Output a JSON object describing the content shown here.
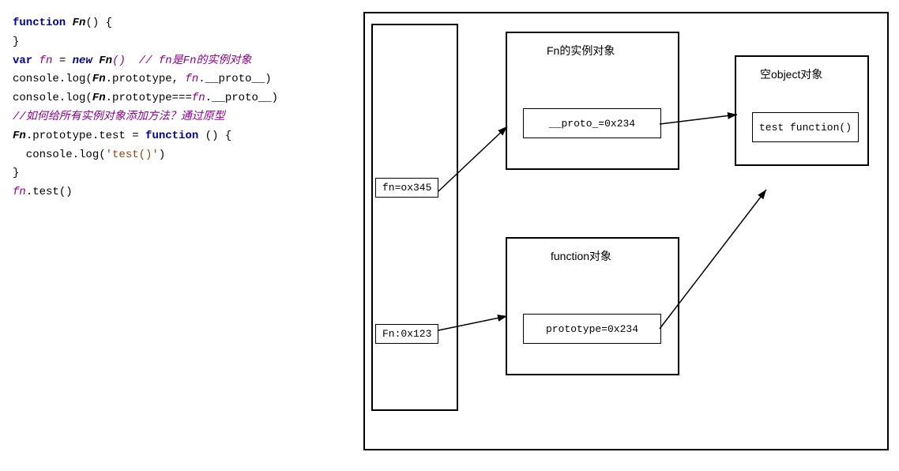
{
  "code": {
    "lines": [
      {
        "id": "l1",
        "parts": [
          {
            "text": "function ",
            "cls": "kw"
          },
          {
            "text": "Fn",
            "cls": "fn-name"
          },
          {
            "text": "() {",
            "cls": "plain"
          }
        ]
      },
      {
        "id": "l2",
        "parts": [
          {
            "text": "",
            "cls": "plain"
          }
        ]
      },
      {
        "id": "l3",
        "parts": [
          {
            "text": "}",
            "cls": "plain"
          }
        ]
      },
      {
        "id": "l4",
        "parts": [
          {
            "text": "var ",
            "cls": "var-kw"
          },
          {
            "text": "fn",
            "cls": "var-name"
          },
          {
            "text": " = ",
            "cls": "plain"
          },
          {
            "text": "new ",
            "cls": "new-kw"
          },
          {
            "text": "Fn",
            "cls": "fn-name"
          },
          {
            "text": "()  // fn是Fn的实例对象",
            "cls": "comment"
          }
        ]
      },
      {
        "id": "l5",
        "parts": [
          {
            "text": "console.log(",
            "cls": "method"
          },
          {
            "text": "Fn",
            "cls": "fn-name"
          },
          {
            "text": ".prototype, ",
            "cls": "plain"
          },
          {
            "text": "fn",
            "cls": "fn-italic"
          },
          {
            "text": ".__proto__)",
            "cls": "plain"
          }
        ]
      },
      {
        "id": "l6",
        "parts": [
          {
            "text": "console.log(",
            "cls": "method"
          },
          {
            "text": "Fn",
            "cls": "fn-name"
          },
          {
            "text": ".prototype===",
            "cls": "plain"
          },
          {
            "text": "fn",
            "cls": "fn-italic"
          },
          {
            "text": ".__proto__)",
            "cls": "plain"
          }
        ]
      },
      {
        "id": "l7",
        "parts": [
          {
            "text": "",
            "cls": "plain"
          }
        ]
      },
      {
        "id": "l8",
        "parts": [
          {
            "text": "//如何给所有实例对象添加方法？通过原型",
            "cls": "comment"
          }
        ]
      },
      {
        "id": "l9",
        "parts": [
          {
            "text": "Fn",
            "cls": "fn-name"
          },
          {
            "text": ".prototype.test = ",
            "cls": "plain"
          },
          {
            "text": "function",
            "cls": "proto-b"
          },
          {
            "text": " () {",
            "cls": "plain"
          }
        ]
      },
      {
        "id": "l10",
        "parts": [
          {
            "text": "  console.log(",
            "cls": "method"
          },
          {
            "text": "'test()'",
            "cls": "string"
          },
          {
            "text": ")",
            "cls": "plain"
          }
        ]
      },
      {
        "id": "l11",
        "parts": [
          {
            "text": "}",
            "cls": "plain"
          }
        ]
      },
      {
        "id": "l12",
        "parts": [
          {
            "text": "fn",
            "cls": "fn-italic"
          },
          {
            "text": ".test()",
            "cls": "plain"
          }
        ]
      }
    ]
  },
  "diagram": {
    "instance_box_title": "Fn的实例对象",
    "proto_label": "__proto_=0x234",
    "fn_label": "fn=ox345",
    "fn_addr": "Fn:0x123",
    "function_box_title": "function对象",
    "prototype_label": "prototype=0x234",
    "object_box_title": "空object对象",
    "test_label": "test function()"
  }
}
